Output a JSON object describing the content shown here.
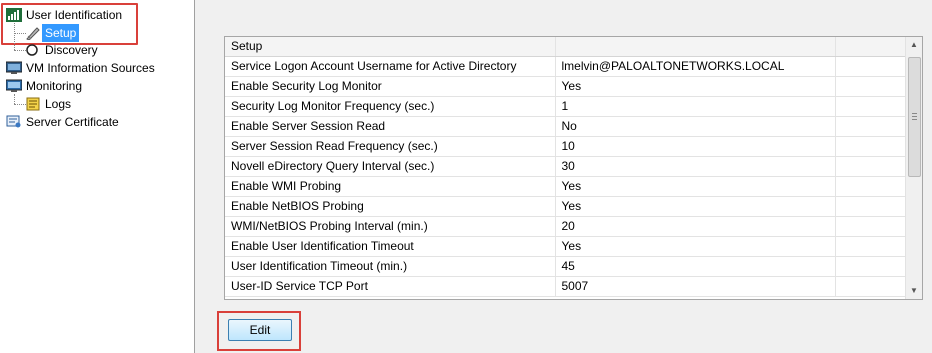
{
  "tree": {
    "items": [
      {
        "label": "User Identification",
        "icon": "bar-chart-icon"
      },
      {
        "label": "Setup",
        "icon": "wrench-icon",
        "selected": true
      },
      {
        "label": "Discovery",
        "icon": "circle-icon"
      },
      {
        "label": "VM Information Sources",
        "icon": "monitor-icon"
      },
      {
        "label": "Monitoring",
        "icon": "monitor-icon"
      },
      {
        "label": "Logs",
        "icon": "scroll-icon"
      },
      {
        "label": "Server Certificate",
        "icon": "certificate-icon"
      }
    ]
  },
  "grid": {
    "header": "Setup",
    "rows": [
      {
        "name": "Service Logon Account Username for Active Directory",
        "value": "lmelvin@PALOALTONETWORKS.LOCAL"
      },
      {
        "name": "Enable Security Log Monitor",
        "value": "Yes"
      },
      {
        "name": "Security Log Monitor Frequency (sec.)",
        "value": "1"
      },
      {
        "name": "Enable Server Session Read",
        "value": "No"
      },
      {
        "name": "Server Session Read Frequency (sec.)",
        "value": "10"
      },
      {
        "name": "Novell eDirectory Query Interval (sec.)",
        "value": "30"
      },
      {
        "name": "Enable WMI Probing",
        "value": "Yes"
      },
      {
        "name": "Enable NetBIOS Probing",
        "value": "Yes"
      },
      {
        "name": "WMI/NetBIOS Probing Interval (min.)",
        "value": "20"
      },
      {
        "name": "Enable User Identification Timeout",
        "value": "Yes"
      },
      {
        "name": "User Identification Timeout (min.)",
        "value": "45"
      },
      {
        "name": "User-ID Service TCP Port",
        "value": "5007"
      }
    ]
  },
  "edit_button": {
    "label": "Edit"
  },
  "colors": {
    "highlight": "#d9403a",
    "selection": "#3399ff",
    "button_border": "#3c7fb1"
  }
}
